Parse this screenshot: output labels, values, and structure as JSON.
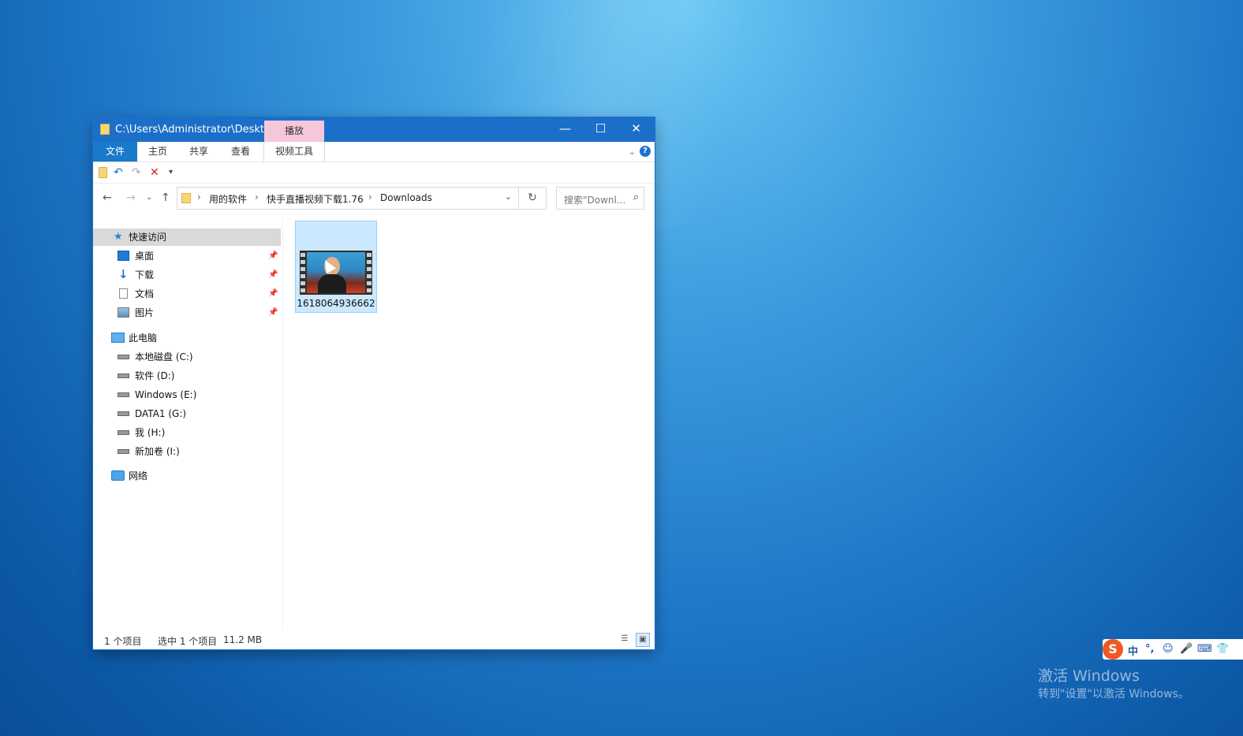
{
  "window": {
    "title": "C:\\Users\\Administrator\\Deskto...",
    "context_tab": "播放",
    "minimize_glyph": "—",
    "maximize_glyph": "☐",
    "close_glyph": "✕"
  },
  "ribbon": {
    "tabs": [
      "文件",
      "主页",
      "共享",
      "查看",
      "视频工具"
    ],
    "help_glyph": "?"
  },
  "nav": {
    "breadcrumb": [
      "用的软件",
      "快手直播视频下载1.76",
      "Downloads"
    ],
    "search_placeholder": "搜索\"Downl...",
    "refresh_glyph": "↻"
  },
  "sidebar": {
    "quick_access": "快速访问",
    "quick_items": [
      "桌面",
      "下载",
      "文档",
      "图片"
    ],
    "this_pc": "此电脑",
    "drives": [
      "本地磁盘 (C:)",
      "软件 (D:)",
      "Windows (E:)",
      "DATA1 (G:)",
      "我 (H:)",
      "新加卷 (I:)"
    ],
    "network": "网络"
  },
  "content": {
    "files": [
      {
        "name": "1618064936662",
        "type": "video",
        "selected": true
      }
    ]
  },
  "status": {
    "count": "1 个项目",
    "selected": "选中 1 个项目",
    "size": "11.2 MB"
  },
  "ime": {
    "logo": "S",
    "items": [
      "中",
      "°,",
      "☺",
      "🎤",
      "⌨",
      "👕"
    ]
  },
  "watermark": {
    "line1": "激活 Windows",
    "line2": "转到\"设置\"以激活 Windows。"
  },
  "colors": {
    "title_bar": "#1b6fc9",
    "context_tab": "#f6c7da",
    "selection": "#cce8ff"
  }
}
